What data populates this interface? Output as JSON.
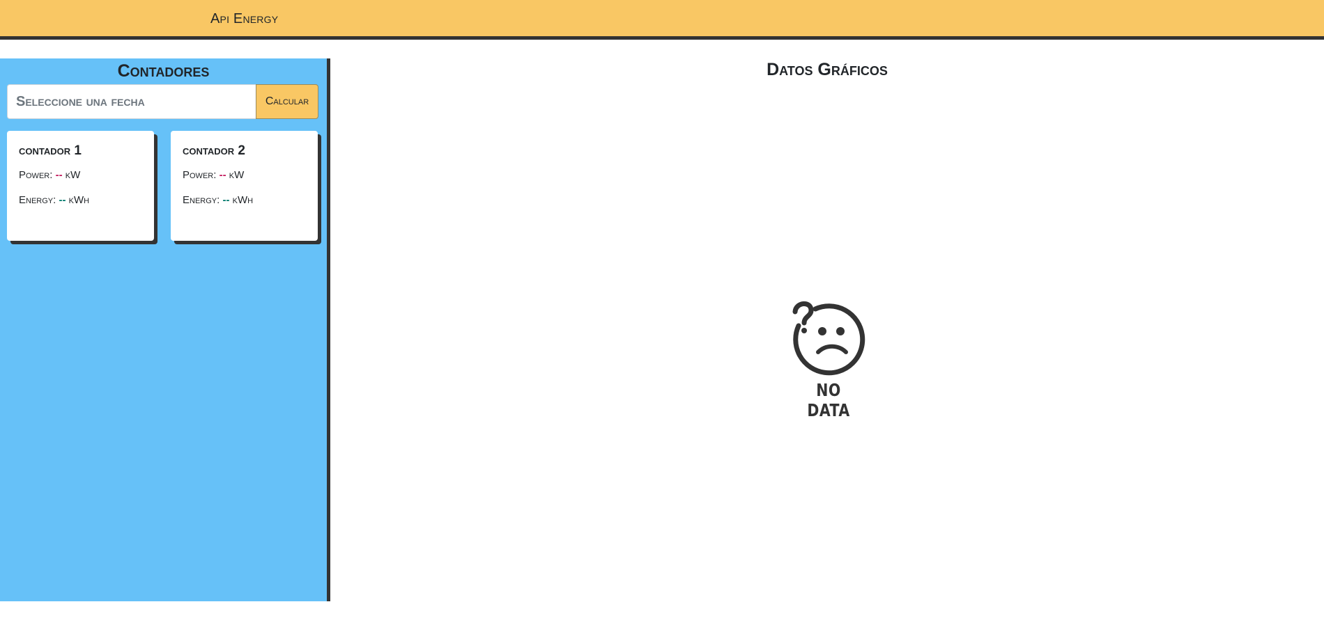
{
  "header": {
    "brand": "Api Energy"
  },
  "sidebar": {
    "title": "Contadores",
    "search": {
      "placeholder": "Seleccione una fecha",
      "button_label": "Calcular"
    },
    "meters": [
      {
        "title": "contador 1",
        "power_label": "Power:",
        "power_value": "--",
        "power_unit": "kW",
        "energy_label": "Energy:",
        "energy_value": "--",
        "energy_unit": "kWh"
      },
      {
        "title": "contador 2",
        "power_label": "Power:",
        "power_value": "--",
        "power_unit": "kW",
        "energy_label": "Energy:",
        "energy_value": "--",
        "energy_unit": "kWh"
      }
    ]
  },
  "main": {
    "title": "Datos Gráficos",
    "empty_state": {
      "icon": "confused-face-icon",
      "text": "NO DATA"
    }
  },
  "colors": {
    "header_bg": "#f9c764",
    "sidebar_bg": "#66c1f8",
    "border_dark": "#333333",
    "power_value": "#c2185b",
    "energy_value": "#00796b"
  }
}
